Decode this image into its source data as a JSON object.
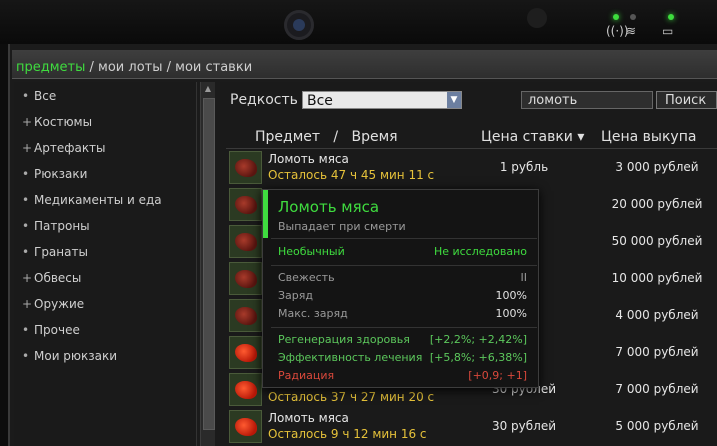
{
  "breadcrumb": {
    "active": "предметы",
    "sep1": " / ",
    "item2": "мои лоты",
    "sep2": " / ",
    "item3": "мои ставки"
  },
  "sidebar": {
    "items": [
      {
        "bullet": "•",
        "label": "Все"
      },
      {
        "bullet": "+",
        "label": "Костюмы"
      },
      {
        "bullet": "+",
        "label": "Артефакты"
      },
      {
        "bullet": "•",
        "label": "Рюкзаки"
      },
      {
        "bullet": "•",
        "label": "Медикаменты и еда"
      },
      {
        "bullet": "•",
        "label": "Патроны"
      },
      {
        "bullet": "•",
        "label": "Гранаты"
      },
      {
        "bullet": "+",
        "label": "Обвесы"
      },
      {
        "bullet": "+",
        "label": "Оружие"
      },
      {
        "bullet": "•",
        "label": "Прочее"
      },
      {
        "bullet": "•",
        "label": "Мои рюкзаки"
      }
    ]
  },
  "filter": {
    "rarity_label": "Редкость",
    "rarity_value": "Все",
    "search_value": "ломоть",
    "search_button": "Поиск"
  },
  "table": {
    "col_item": "Предмет",
    "col_sep": "/",
    "col_time": "Время",
    "col_price": "Цена ставки ▾",
    "col_buy": "Цена выкупа",
    "rows": [
      {
        "name": "Ломоть мяса",
        "time": "Осталось 47 ч 45 мин 11 с",
        "price": "1 рубль",
        "buy": "3 000 рублей"
      },
      {
        "name": "",
        "time": "",
        "price": "ль",
        "buy": "20 000 рублей"
      },
      {
        "name": "",
        "time": "",
        "price": "ля",
        "buy": "50 000 рублей"
      },
      {
        "name": "",
        "time": "",
        "price": "ля",
        "buy": "10 000 рублей"
      },
      {
        "name": "",
        "time": "",
        "price": "лей",
        "buy": "4 000 рублей"
      },
      {
        "name": "",
        "time": "",
        "price": "лей",
        "buy": "7 000 рублей"
      },
      {
        "name": "",
        "time": "Осталось 37 ч 27 мин 20 с",
        "price": "30 рублей",
        "buy": "7 000 рублей"
      },
      {
        "name": "Ломоть мяса",
        "time": "Осталось 9 ч 12 мин 16 с",
        "price": "30 рублей",
        "buy": "5 000 рублей"
      }
    ]
  },
  "tooltip": {
    "title": "Ломоть мяса",
    "subtitle": "Выпадает при смерти",
    "rarity": "Необычный",
    "research": "Не исследовано",
    "freshness_label": "Свежесть",
    "freshness_value": "II",
    "charge_label": "Заряд",
    "charge_value": "100%",
    "max_charge_label": "Макс. заряд",
    "max_charge_value": "100%",
    "regen_label": "Регенерация здоровья",
    "regen_value": "[+2,2%; +2,42%]",
    "heal_label": "Эффективность лечения",
    "heal_value": "[+5,8%; +6,38%]",
    "rad_label": "Радиация",
    "rad_value": "[+0,9; +1]"
  },
  "colors": {
    "accent_green": "#3fdc3f",
    "time_yellow": "#e6c23a",
    "negative_red": "#d9483b",
    "positive_green": "#5cc85c"
  }
}
